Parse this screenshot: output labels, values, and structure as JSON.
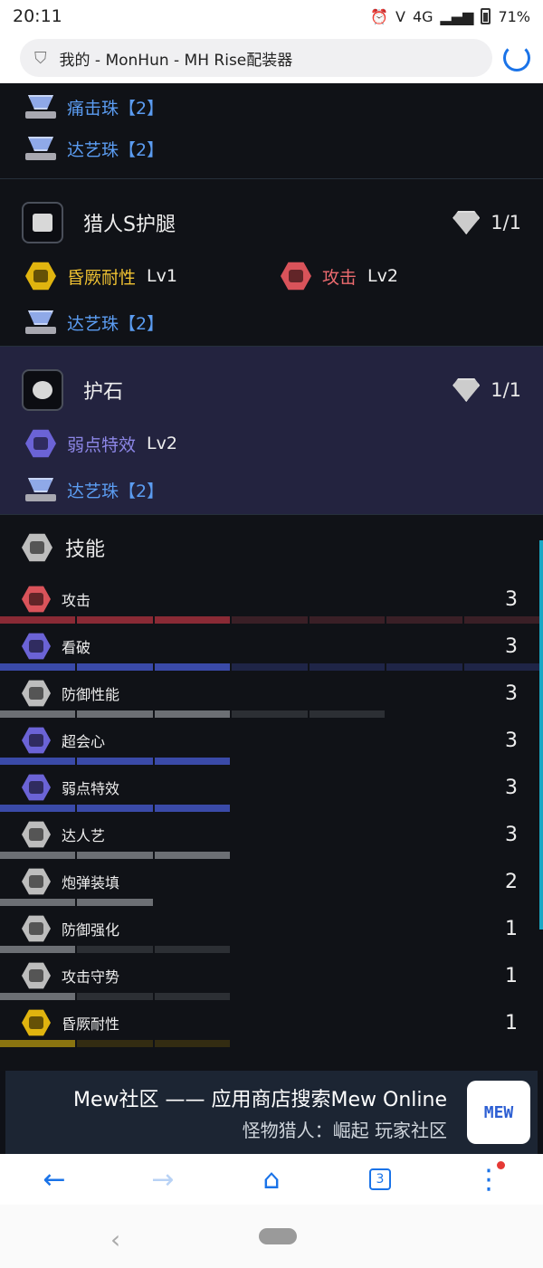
{
  "status": {
    "time": "20:11",
    "network": "4G",
    "battery": "71%"
  },
  "browser": {
    "page_title": "我的 - MonHun - MH Rise配装器"
  },
  "top_decos": [
    {
      "name": "痛击珠【2】"
    },
    {
      "name": "达艺珠【2】"
    }
  ],
  "legs": {
    "name": "猎人S护腿",
    "slots": "1/1",
    "skills": [
      {
        "name": "昏厥耐性",
        "level": "Lv1",
        "color": "#e0b40f",
        "name_color": "#f0c232"
      },
      {
        "name": "攻击",
        "level": "Lv2",
        "color": "#d9535a",
        "name_color": "#ec6b6f"
      }
    ],
    "decos": [
      {
        "name": "达艺珠【2】"
      }
    ]
  },
  "charm": {
    "name": "护石",
    "slots": "1/1",
    "skills": [
      {
        "name": "弱点特效",
        "level": "Lv2",
        "color": "#6b63d6",
        "name_color": "#8c86e6"
      }
    ],
    "decos": [
      {
        "name": "达艺珠【2】"
      }
    ]
  },
  "skills_section": {
    "title": "技能",
    "items": [
      {
        "name": "攻击",
        "level": "3",
        "max": 7,
        "color": "#d9535a",
        "bar": "#8a2a35",
        "bg": "#3a1f26"
      },
      {
        "name": "看破",
        "level": "3",
        "max": 7,
        "color": "#6b63d6",
        "bar": "#3a4aa8",
        "bg": "#1f2547"
      },
      {
        "name": "防御性能",
        "level": "3",
        "max": 5,
        "color": "#bdbdbd",
        "bar": "#6c6f74",
        "bg": "#2c2f34"
      },
      {
        "name": "超会心",
        "level": "3",
        "max": 3,
        "color": "#6b63d6",
        "bar": "#3a4aa8",
        "bg": "#1f2547"
      },
      {
        "name": "弱点特效",
        "level": "3",
        "max": 3,
        "color": "#6b63d6",
        "bar": "#3a4aa8",
        "bg": "#1f2547"
      },
      {
        "name": "达人艺",
        "level": "3",
        "max": 3,
        "color": "#bdbdbd",
        "bar": "#6c6f74",
        "bg": "#2c2f34"
      },
      {
        "name": "炮弹装填",
        "level": "2",
        "max": 2,
        "color": "#bdbdbd",
        "bar": "#6c6f74",
        "bg": "#2c2f34"
      },
      {
        "name": "防御强化",
        "level": "1",
        "max": 3,
        "color": "#bdbdbd",
        "bar": "#6c6f74",
        "bg": "#2c2f34"
      },
      {
        "name": "攻击守势",
        "level": "1",
        "max": 3,
        "color": "#bdbdbd",
        "bar": "#6c6f74",
        "bg": "#2c2f34"
      },
      {
        "name": "昏厥耐性",
        "level": "1",
        "max": 3,
        "color": "#e0b40f",
        "bar": "#8a7410",
        "bg": "#332c12"
      }
    ]
  },
  "banner": {
    "line1": "Mew社区 —— 应用商店搜索Mew Online",
    "line2": "怪物猎人：崛起 玩家社区",
    "logo": "MEW"
  },
  "bottom_nav": {
    "tab_count": "3"
  }
}
